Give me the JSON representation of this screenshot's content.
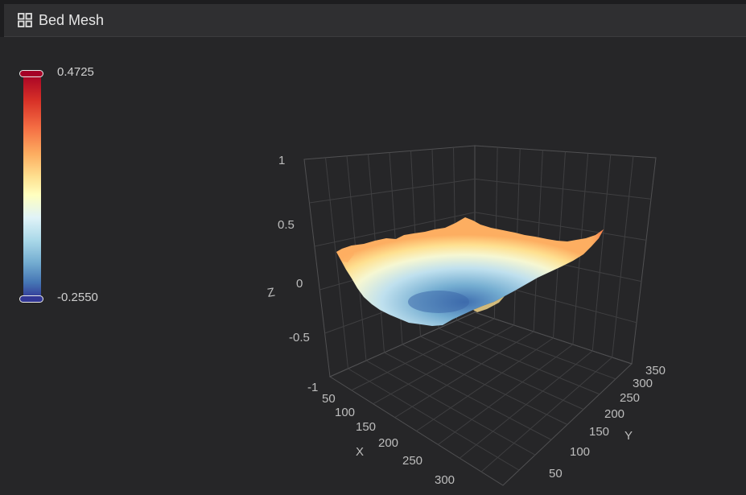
{
  "header": {
    "title": "Bed Mesh",
    "icon": "grid-icon"
  },
  "colorbar": {
    "max_label": "0.4725",
    "min_label": "-0.2550"
  },
  "chart_data": {
    "type": "surface",
    "title": "",
    "zlabel": "Z",
    "xlabel": "X",
    "ylabel": "Y",
    "z_ticks": [
      "1",
      "0.5",
      "0",
      "-0.5",
      "-1"
    ],
    "x_ticks": [
      "50",
      "100",
      "150",
      "200",
      "250",
      "300"
    ],
    "y_ticks": [
      "50",
      "100",
      "150",
      "200",
      "250",
      "300",
      "350"
    ],
    "z_range": [
      -1,
      1
    ],
    "z_min": -0.255,
    "z_max": 0.4725,
    "colorscale": [
      "#313695",
      "#4575b4",
      "#74add1",
      "#abd9e9",
      "#e0f3f8",
      "#ffffbf",
      "#fee090",
      "#fdae61",
      "#f46d43",
      "#d73027",
      "#a50026"
    ]
  }
}
